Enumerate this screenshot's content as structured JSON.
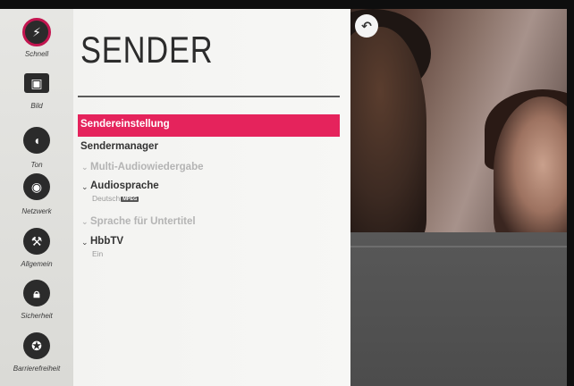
{
  "sidebar": {
    "items": [
      {
        "label": "Schnell",
        "icon": "lightning-icon",
        "glyph": "⚡",
        "active": true
      },
      {
        "label": "Bild",
        "icon": "picture-icon",
        "glyph": "▣"
      },
      {
        "label": "Ton",
        "icon": "sound-icon",
        "glyph": "◖"
      },
      {
        "label": "Netzwerk",
        "icon": "globe-icon",
        "glyph": "◉"
      },
      {
        "label": "Allgemein",
        "icon": "tools-icon",
        "glyph": "⚒"
      },
      {
        "label": "Sicherheit",
        "icon": "lock-icon",
        "glyph": "🔒︎"
      },
      {
        "label": "Barrierefreiheit",
        "icon": "accessibility-icon",
        "glyph": "✪"
      }
    ]
  },
  "menu": {
    "title": "SENDER",
    "items": [
      {
        "label": "Sendereinstellung",
        "state": "selected"
      },
      {
        "label": "Sendermanager",
        "state": "normal"
      },
      {
        "label": "Multi-Audiowiedergabe",
        "state": "disabled",
        "expandable": true
      },
      {
        "label": "Audiosprache",
        "state": "normal",
        "expandable": true,
        "value": "Deutsch",
        "badge": "MPEG"
      },
      {
        "label": "Sprache für Untertitel",
        "state": "disabled",
        "expandable": true
      },
      {
        "label": "HbbTV",
        "state": "normal",
        "expandable": true,
        "value": "Ein"
      }
    ]
  },
  "back_button": {
    "glyph": "↶"
  },
  "colors": {
    "accent": "#e5235c",
    "active_ring": "#c2154f",
    "panel": "#f4f4f2"
  }
}
